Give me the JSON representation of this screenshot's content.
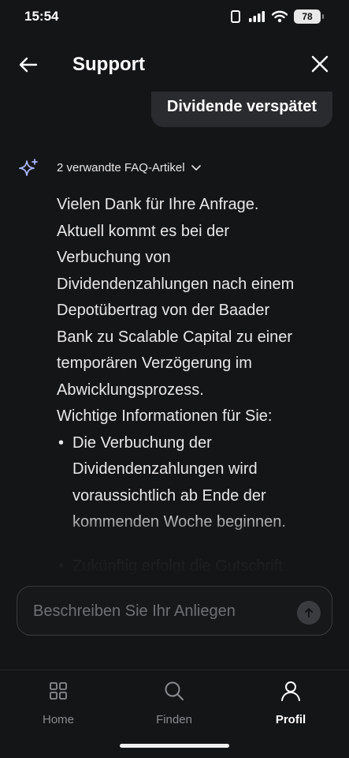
{
  "status_bar": {
    "time": "15:54",
    "battery": "78"
  },
  "header": {
    "title": "Support"
  },
  "chat": {
    "user_message": "Dividende verspätet",
    "faq_link": "2 verwandte FAQ-Artikel",
    "bot_lines": [
      "Vielen Dank für Ihre Anfrage.",
      "Aktuell kommt es bei der",
      "Verbuchung von",
      "Dividendenzahlungen nach einem",
      "Depotübertrag von der Baader",
      "Bank zu Scalable Capital zu einer",
      "temporären Verzögerung im",
      "Abwicklungsprozess.",
      "Wichtige Informationen für Sie:"
    ],
    "bullets": [
      "Die Verbuchung der Dividendenzahlungen wird voraussichtlich ab Ende der kommenden Woche beginnen.",
      "Zukünftig erfolgt die Gutschrift"
    ]
  },
  "input": {
    "placeholder": "Beschreiben Sie Ihr Anliegen"
  },
  "nav": {
    "home": "Home",
    "search": "Finden",
    "profile": "Profil"
  },
  "colors": {
    "background": "#141517",
    "bubble": "#2a2b2e",
    "accent_sparkle": "#a9b4ff"
  },
  "icons": [
    "back-arrow-icon",
    "close-icon",
    "sparkle-icon",
    "chevron-down-icon",
    "send-arrow-icon",
    "grid-icon",
    "search-icon",
    "person-icon"
  ]
}
